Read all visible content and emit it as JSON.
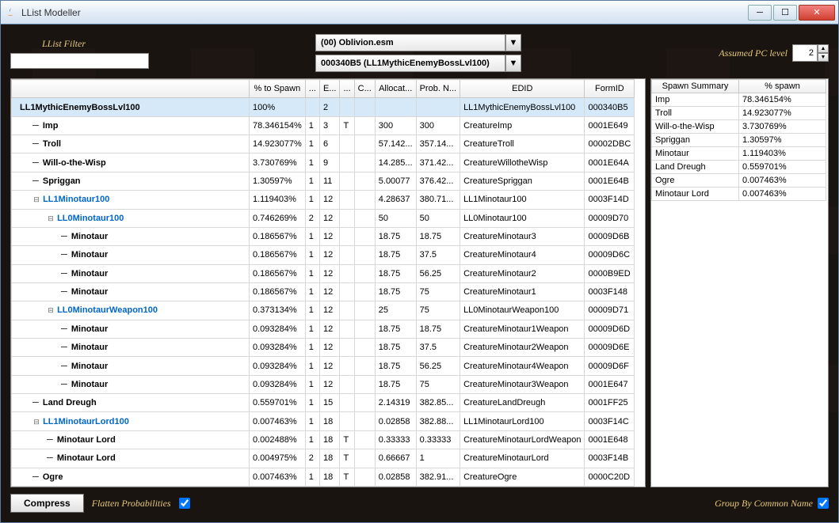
{
  "window": {
    "title": "LList Modeller"
  },
  "filter": {
    "label": "LList Filter",
    "value": ""
  },
  "dropdowns": {
    "plugin": "(00) Oblivion.esm",
    "list": "000340B5 (LL1MythicEnemyBossLvl100)"
  },
  "pclevel": {
    "label": "Assumed PC level",
    "value": "2"
  },
  "columns": {
    "main": [
      "",
      "% to Spawn",
      "...",
      "E...",
      "...",
      "C...",
      "Allocat...",
      "Prob. N...",
      "EDID",
      "FormID"
    ],
    "summary": [
      "Spawn Summary",
      "% spawn"
    ]
  },
  "tree": [
    {
      "depth": 0,
      "label": "LL1MythicEnemyBossLvl100",
      "root": true,
      "pct": "100%",
      "c2": "",
      "c3": "2",
      "c4": "",
      "c5": "",
      "c6": "",
      "c7": "",
      "edid": "LL1MythicEnemyBossLvl100",
      "formid": "000340B5"
    },
    {
      "depth": 1,
      "label": "Imp",
      "pct": "78.346154%",
      "c2": "1",
      "c3": "3",
      "c4": "T",
      "c5": "",
      "c6": "300",
      "c7": "300",
      "edid": "CreatureImp",
      "formid": "0001E649"
    },
    {
      "depth": 1,
      "label": "Troll",
      "pct": "14.923077%",
      "c2": "1",
      "c3": "6",
      "c4": "",
      "c5": "",
      "c6": "57.142...",
      "c7": "357.14...",
      "edid": "CreatureTroll",
      "formid": "00002DBC"
    },
    {
      "depth": 1,
      "label": "Will-o-the-Wisp",
      "pct": "3.730769%",
      "c2": "1",
      "c3": "9",
      "c4": "",
      "c5": "",
      "c6": "14.285...",
      "c7": "371.42...",
      "edid": "CreatureWillotheWisp",
      "formid": "0001E64A"
    },
    {
      "depth": 1,
      "label": "Spriggan",
      "pct": "1.30597%",
      "c2": "1",
      "c3": "11",
      "c4": "",
      "c5": "",
      "c6": "5.00077",
      "c7": "376.42...",
      "edid": "CreatureSpriggan",
      "formid": "0001E64B"
    },
    {
      "depth": 1,
      "label": "LL1Minotaur100",
      "link": true,
      "toggle": "open",
      "pct": "1.119403%",
      "c2": "1",
      "c3": "12",
      "c4": "",
      "c5": "",
      "c6": "4.28637",
      "c7": "380.71...",
      "edid": "LL1Minotaur100",
      "formid": "0003F14D"
    },
    {
      "depth": 2,
      "label": "LL0Minotaur100",
      "link": true,
      "toggle": "open",
      "pct": "0.746269%",
      "c2": "2",
      "c3": "12",
      "c4": "",
      "c5": "",
      "c6": "50",
      "c7": "50",
      "edid": "LL0Minotaur100",
      "formid": "00009D70"
    },
    {
      "depth": 3,
      "label": "Minotaur",
      "pct": "0.186567%",
      "c2": "1",
      "c3": "12",
      "c4": "",
      "c5": "",
      "c6": "18.75",
      "c7": "18.75",
      "edid": "CreatureMinotaur3",
      "formid": "00009D6B"
    },
    {
      "depth": 3,
      "label": "Minotaur",
      "pct": "0.186567%",
      "c2": "1",
      "c3": "12",
      "c4": "",
      "c5": "",
      "c6": "18.75",
      "c7": "37.5",
      "edid": "CreatureMinotaur4",
      "formid": "00009D6C"
    },
    {
      "depth": 3,
      "label": "Minotaur",
      "pct": "0.186567%",
      "c2": "1",
      "c3": "12",
      "c4": "",
      "c5": "",
      "c6": "18.75",
      "c7": "56.25",
      "edid": "CreatureMinotaur2",
      "formid": "0000B9ED"
    },
    {
      "depth": 3,
      "label": "Minotaur",
      "pct": "0.186567%",
      "c2": "1",
      "c3": "12",
      "c4": "",
      "c5": "",
      "c6": "18.75",
      "c7": "75",
      "edid": "CreatureMinotaur1",
      "formid": "0003F148"
    },
    {
      "depth": 2,
      "label": "LL0MinotaurWeapon100",
      "link": true,
      "toggle": "open",
      "pct": "0.373134%",
      "c2": "1",
      "c3": "12",
      "c4": "",
      "c5": "",
      "c6": "25",
      "c7": "75",
      "edid": "LL0MinotaurWeapon100",
      "formid": "00009D71"
    },
    {
      "depth": 3,
      "label": "Minotaur",
      "pct": "0.093284%",
      "c2": "1",
      "c3": "12",
      "c4": "",
      "c5": "",
      "c6": "18.75",
      "c7": "18.75",
      "edid": "CreatureMinotaur1Weapon",
      "formid": "00009D6D"
    },
    {
      "depth": 3,
      "label": "Minotaur",
      "pct": "0.093284%",
      "c2": "1",
      "c3": "12",
      "c4": "",
      "c5": "",
      "c6": "18.75",
      "c7": "37.5",
      "edid": "CreatureMinotaur2Weapon",
      "formid": "00009D6E"
    },
    {
      "depth": 3,
      "label": "Minotaur",
      "pct": "0.093284%",
      "c2": "1",
      "c3": "12",
      "c4": "",
      "c5": "",
      "c6": "18.75",
      "c7": "56.25",
      "edid": "CreatureMinotaur4Weapon",
      "formid": "00009D6F"
    },
    {
      "depth": 3,
      "label": "Minotaur",
      "pct": "0.093284%",
      "c2": "1",
      "c3": "12",
      "c4": "",
      "c5": "",
      "c6": "18.75",
      "c7": "75",
      "edid": "CreatureMinotaur3Weapon",
      "formid": "0001E647"
    },
    {
      "depth": 1,
      "label": "Land Dreugh",
      "pct": "0.559701%",
      "c2": "1",
      "c3": "15",
      "c4": "",
      "c5": "",
      "c6": "2.14319",
      "c7": "382.85...",
      "edid": "CreatureLandDreugh",
      "formid": "0001FF25"
    },
    {
      "depth": 1,
      "label": "LL1MinotaurLord100",
      "link": true,
      "toggle": "open",
      "pct": "0.007463%",
      "c2": "1",
      "c3": "18",
      "c4": "",
      "c5": "",
      "c6": "0.02858",
      "c7": "382.88...",
      "edid": "LL1MinotaurLord100",
      "formid": "0003F14C"
    },
    {
      "depth": 2,
      "label": "Minotaur Lord",
      "pct": "0.002488%",
      "c2": "1",
      "c3": "18",
      "c4": "T",
      "c5": "",
      "c6": "0.33333",
      "c7": "0.33333",
      "edid": "CreatureMinotaurLordWeapon",
      "formid": "0001E648"
    },
    {
      "depth": 2,
      "label": "Minotaur Lord",
      "pct": "0.004975%",
      "c2": "2",
      "c3": "18",
      "c4": "T",
      "c5": "",
      "c6": "0.66667",
      "c7": "1",
      "edid": "CreatureMinotaurLord",
      "formid": "0003F14B"
    },
    {
      "depth": 1,
      "label": "Ogre",
      "pct": "0.007463%",
      "c2": "1",
      "c3": "18",
      "c4": "T",
      "c5": "",
      "c6": "0.02858",
      "c7": "382.91...",
      "edid": "CreatureOgre",
      "formid": "0000C20D"
    }
  ],
  "summary": [
    {
      "name": "Imp",
      "pct": "78.346154%"
    },
    {
      "name": "Troll",
      "pct": "14.923077%"
    },
    {
      "name": "Will-o-the-Wisp",
      "pct": "3.730769%"
    },
    {
      "name": "Spriggan",
      "pct": "1.30597%"
    },
    {
      "name": "Minotaur",
      "pct": "1.119403%"
    },
    {
      "name": "Land Dreugh",
      "pct": "0.559701%"
    },
    {
      "name": "Ogre",
      "pct": "0.007463%"
    },
    {
      "name": "Minotaur Lord",
      "pct": "0.007463%"
    }
  ],
  "bottom": {
    "compress": "Compress",
    "flatten": "Flatten Probabilities",
    "group": "Group By Common Name"
  }
}
